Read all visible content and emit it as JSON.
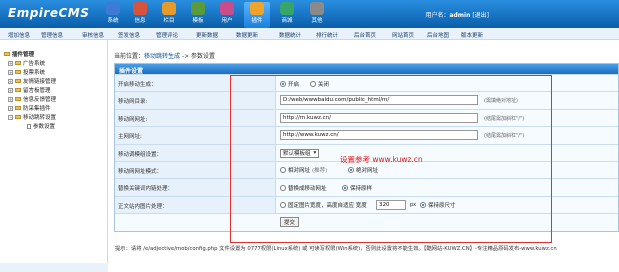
{
  "app": {
    "logo": "EmpireCMS"
  },
  "toolbar": [
    {
      "label": "系统",
      "color": "#3d7ad6"
    },
    {
      "label": "信息",
      "color": "#d8533b"
    },
    {
      "label": "栏目",
      "color": "#e59a2a"
    },
    {
      "label": "模板",
      "color": "#5a9a3a"
    },
    {
      "label": "用户",
      "color": "#c94c8c"
    },
    {
      "label": "插件",
      "color": "#f0a32a",
      "active": true
    },
    {
      "label": "商城",
      "color": "#37a56a"
    },
    {
      "label": "其他",
      "color": "#8a8a8a"
    }
  ],
  "user": {
    "prefix": "用户名：",
    "name": "admin",
    "logout": "[退出]"
  },
  "nav": [
    "增加信息",
    "管理信息",
    "审核信息",
    "签发信息",
    "管理评论",
    "更新数据",
    "数据更新",
    "数据统计",
    "排行统计",
    "后台首页",
    "网站首页",
    "后台地图",
    "版本更新"
  ],
  "sidebar": {
    "root": "插件管理",
    "items": [
      "广告系统",
      "投票系统",
      "友情链接管理",
      "留言板管理",
      "信息反馈管理",
      "防采集插件",
      "移动跳转设置"
    ],
    "sub": "参数设置"
  },
  "crumb": {
    "prefix": "当前位置：",
    "link": "移动跳转生成",
    "suffix": " -> 参数设置"
  },
  "panel": {
    "title": "插件设置",
    "rows": {
      "enable": {
        "label": "开启移动生成：",
        "on": "开启",
        "off": "关闭"
      },
      "dir": {
        "label": "移动网目录:",
        "value": "D:/web/wwwbaidu.com/public_html/m/",
        "hint": "(需填绝对地址)"
      },
      "mobile_url": {
        "label": "移动网网址:",
        "value": "http://m.kuwz.cn/",
        "hint": "(结尾需加斜杠\"/\")"
      },
      "main_url": {
        "label": "主网网址:",
        "value": "http://www.kuwz.cn/",
        "hint": "(结尾需加斜杠\"/\")"
      },
      "template": {
        "label": "移动调模组设置：",
        "value": "默认模板组"
      },
      "link_mode": {
        "label": "移动网网址模式：",
        "opt1": "相对网址",
        "opt1_hint": "(推荐)",
        "opt2": "绝对网址"
      },
      "replace": {
        "label": "替换关键词内链处理：",
        "opt1": "替换成移动网址",
        "opt2": "保持原样"
      },
      "image": {
        "label": "正文站内图片处理：",
        "opt1": "固定图片宽度，高度自适应 宽度",
        "width": "320",
        "unit": "px",
        "opt2": "保持原尺寸"
      },
      "submit": "提交"
    }
  },
  "note": "设置参考 www.kuwz.cn",
  "footer": "提示：请将 /e/adjective/mob/config.php 文件设置为 0777权限(Linux系统) 或 可读写权限(Win系统)，否则此设置将不能生效。【酷网站-KUWZ.CN】-专注精品原码发布-www.kuwz.cn"
}
